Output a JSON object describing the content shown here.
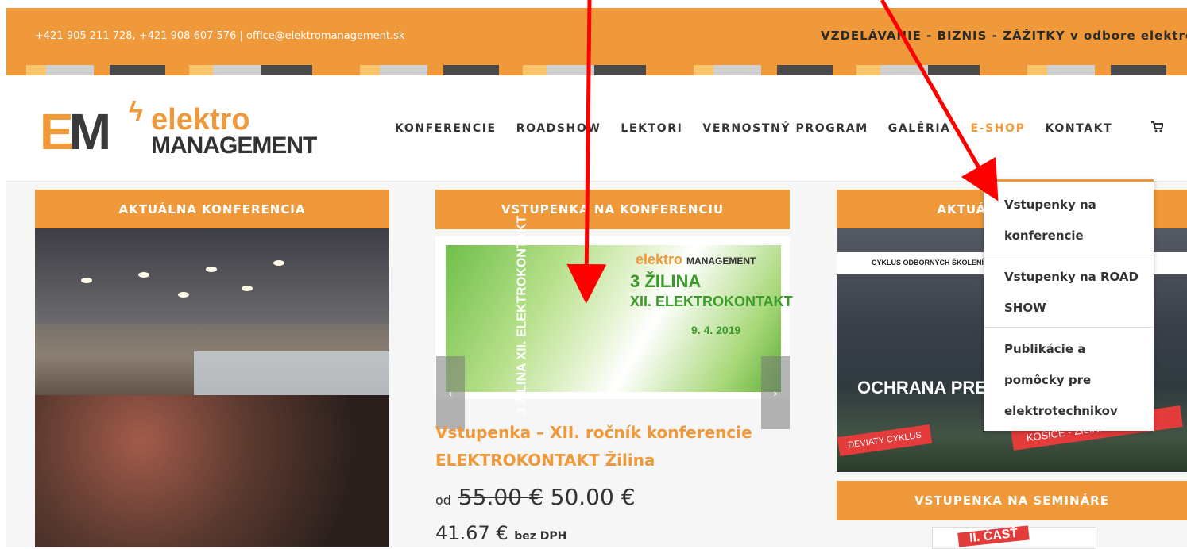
{
  "topbar": {
    "contact": "+421 905 211 728, +421 908 607 576  |  office@elektromanagement.sk",
    "tagline": "VZDELÁVANIE - BIZNIS - ZÁŽITKY v odbore elektro"
  },
  "logo": {
    "em_e": "E",
    "em_m": "M",
    "line1": "elektro",
    "line2": "MANAGEMENT"
  },
  "nav": {
    "items": [
      "KONFERENCIE",
      "ROADSHOW",
      "LEKTORI",
      "VERNOSTNÝ PROGRAM",
      "GALÉRIA",
      "E-SHOP",
      "KONTAKT"
    ],
    "active": "E-SHOP",
    "cart_icon": "shopping-cart-icon"
  },
  "cards": {
    "left_title": "AKTUÁLNA KONFERENCIA",
    "middle_title": "VSTUPENKA NA KONFERENCIU",
    "right_title": "AKTUÁLNY SEMINÁR",
    "right_bottom_title": "VSTUPENKA NA SEMINÁRE"
  },
  "banner": {
    "vertical": "3 ŽILINA XII. ELEKTROKONTAKT",
    "logo_text": "elektro",
    "logo_sub": "MANAGEMENT",
    "city": "3  ŽILINA",
    "subtitle": "XII. ELEKTROKONTAKT",
    "date": "9. 4. 2019"
  },
  "product": {
    "title": "Vstupenka – XII. ročník konferencie ELEKTROKONTAKT Žilina",
    "od": "od",
    "old_price": "55.00 €",
    "new_price": "50.00 €",
    "net_price": "41.67 €",
    "net_label": "bez DPH"
  },
  "seminar_banner": {
    "header": "CYKLUS ODBORNÝCH ŠKOLENÍ",
    "title": "OCHRANA PRED BLESKOM",
    "cycle": "DEVIATY CYKLUS",
    "cities": "KOŠICE - ŽILINA - SENEC"
  },
  "seminar_badge": "II. ČASŤ",
  "dropdown": {
    "items": [
      {
        "l1": "Vstupenky na",
        "l2": "konferencie"
      },
      {
        "l1": "Vstupenky na ROAD",
        "l2": "SHOW"
      },
      {
        "l1": "Publikácie a",
        "l2": "pomôcky pre",
        "l3": "elektrotechnikov"
      }
    ]
  },
  "colors": {
    "accent": "#f0993a",
    "annotation": "#ff0000",
    "dark": "#333333"
  }
}
